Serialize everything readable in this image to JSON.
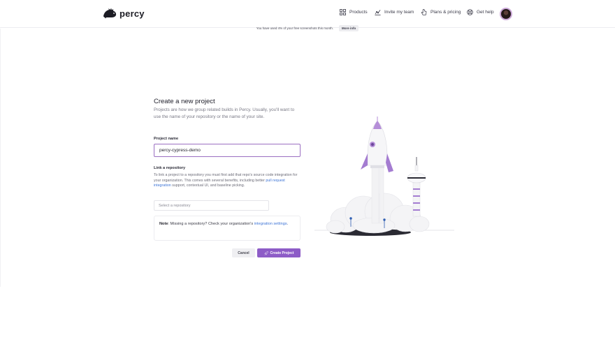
{
  "header": {
    "brand": "percy",
    "nav": {
      "products": "Products",
      "invite": "Invite my team",
      "plans": "Plans & pricing",
      "help": "Get help"
    }
  },
  "banner": {
    "text": "You have used 4% of your free screenshots this month.",
    "button": "More info"
  },
  "form": {
    "title": "Create a new project",
    "description": "Projects are how we group related builds in Percy. Usually, you'll want to use the name of your repository or the name of your site.",
    "project_name_label": "Project name",
    "project_name_value": "percy-cypress-demo",
    "link_repo_label": "Link a repository",
    "link_repo_help_1": "To link a project to a repository you must first add that repo's source code integration for your organization. This comes with several benefits, including better ",
    "link_repo_help_link": "pull request integration",
    "link_repo_help_2": " support, contextual UI, and baseline picking.",
    "repo_select_placeholder": "Select a repository",
    "note_prefix": "Note",
    "note_text": ": Missing a repository? Check your organization's ",
    "note_link": "integration settings",
    "note_end": ".",
    "cancel_label": "Cancel",
    "create_label": "Create Project"
  },
  "colors": {
    "accent": "#8d5cc7",
    "link": "#3d74d6",
    "input_focus_border": "#9b6fc2"
  },
  "icons": {
    "products": "grid-icon",
    "invite": "team-chart-icon",
    "plans": "hand-pointer-icon",
    "help": "lifebuoy-icon",
    "create": "rocket-icon"
  }
}
